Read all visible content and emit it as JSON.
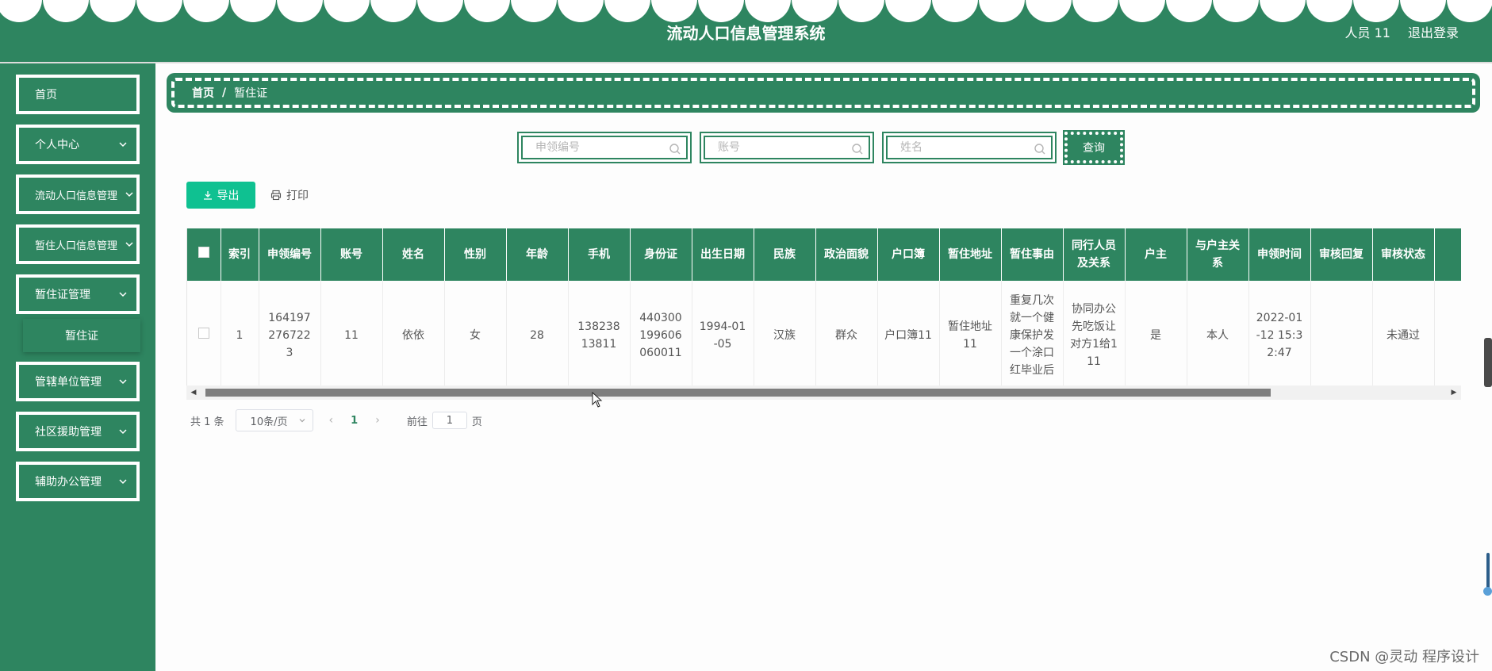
{
  "header": {
    "title": "流动人口信息管理系统",
    "user": "人员 11",
    "logout": "退出登录"
  },
  "sidebar": {
    "items": [
      {
        "label": "首页"
      },
      {
        "label": "个人中心"
      },
      {
        "label": "流动人口信息管理"
      },
      {
        "label": "暂住人口信息管理"
      },
      {
        "label": "暂住证管理"
      },
      {
        "label": "管辖单位管理"
      },
      {
        "label": "社区援助管理"
      },
      {
        "label": "辅助办公管理"
      }
    ],
    "sub_items": [
      {
        "label": "暂住证"
      }
    ]
  },
  "breadcrumb": {
    "home": "首页",
    "separator": "/",
    "current": "暂住证"
  },
  "search": {
    "fields": [
      {
        "placeholder": "申领编号"
      },
      {
        "placeholder": "账号"
      },
      {
        "placeholder": "姓名"
      }
    ],
    "button": "查询"
  },
  "actions": {
    "export": "导出",
    "print": "打印"
  },
  "table": {
    "columns": [
      "索引",
      "申领编号",
      "账号",
      "姓名",
      "性别",
      "年龄",
      "手机",
      "身份证",
      "出生日期",
      "民族",
      "政治面貌",
      "户口簿",
      "暂住地址",
      "暂住事由",
      "同行人员及关系",
      "户主",
      "与户主关系",
      "申领时间",
      "审核回复",
      "审核状态"
    ],
    "rows": [
      {
        "index": "1",
        "apply_no": "1641972767223",
        "account": "11",
        "name": "依依",
        "gender": "女",
        "age": "28",
        "phone": "13823813811",
        "id_card": "440300199606060011",
        "birth_date": "1994-01-05",
        "ethnicity": "汉族",
        "political": "群众",
        "household_book": "户口簿11",
        "temp_address": "暂住地址11",
        "temp_reason": "重复几次就一个健康保护发一个涂口红毕业后",
        "companions": "协同办公先吃饭让对方1给111",
        "householder": "是",
        "relation": "本人",
        "apply_time": "2022-01-12 15:32:47",
        "review_reply": "",
        "review_status": "未通过"
      }
    ]
  },
  "pagination": {
    "total": "共 1 条",
    "page_size": "10条/页",
    "current_page": "1",
    "goto_label": "前往",
    "goto_value": "1",
    "page_suffix": "页"
  },
  "watermark": "CSDN @灵动 程序设计",
  "colors": {
    "primary": "#2e8560",
    "export": "#0fc191"
  }
}
